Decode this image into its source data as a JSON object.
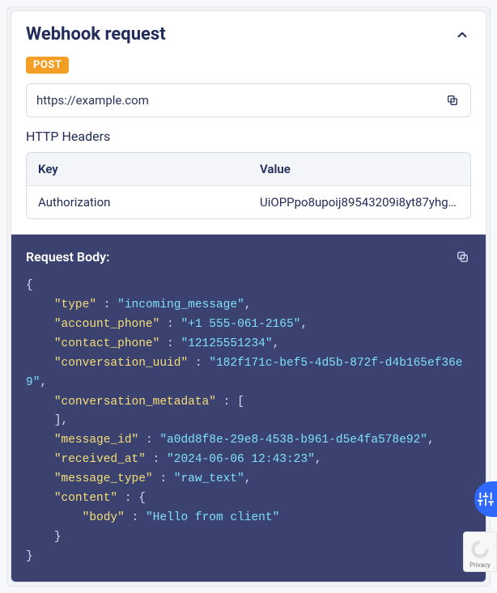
{
  "card": {
    "title": "Webhook request",
    "method_badge": "POST",
    "url": "https://example.com"
  },
  "headers_section": {
    "label": "HTTP Headers",
    "columns": {
      "key": "Key",
      "value": "Value"
    },
    "rows": [
      {
        "key": "Authorization",
        "value": "UiOPPpo8upoij89543209i8yt87yhgi..."
      }
    ]
  },
  "body_section": {
    "label": "Request Body:"
  },
  "request_body_json": {
    "type": "incoming_message",
    "account_phone": "+1 555-061-2165",
    "contact_phone": "12125551234",
    "conversation_uuid": "182f171c-bef5-4d5b-872f-d4b165ef36e9",
    "conversation_metadata": [],
    "message_id": "a0dd8f8e-29e8-4538-b961-d5e4fa578e92",
    "received_at": "2024-06-06 12:43:23",
    "message_type": "raw_text",
    "content": {
      "body": "Hello from client"
    }
  },
  "recaptcha_label": "Privacy"
}
